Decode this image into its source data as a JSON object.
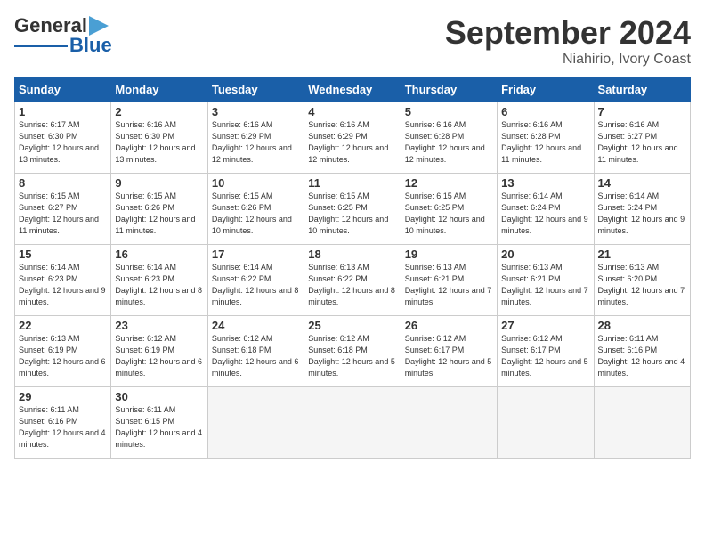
{
  "logo": {
    "line1": "General",
    "line2": "Blue"
  },
  "title": "September 2024",
  "location": "Niahirio, Ivory Coast",
  "days_of_week": [
    "Sunday",
    "Monday",
    "Tuesday",
    "Wednesday",
    "Thursday",
    "Friday",
    "Saturday"
  ],
  "weeks": [
    [
      {
        "day": "1",
        "sunrise": "6:17 AM",
        "sunset": "6:30 PM",
        "daylight": "12 hours and 13 minutes."
      },
      {
        "day": "2",
        "sunrise": "6:16 AM",
        "sunset": "6:30 PM",
        "daylight": "12 hours and 13 minutes."
      },
      {
        "day": "3",
        "sunrise": "6:16 AM",
        "sunset": "6:29 PM",
        "daylight": "12 hours and 12 minutes."
      },
      {
        "day": "4",
        "sunrise": "6:16 AM",
        "sunset": "6:29 PM",
        "daylight": "12 hours and 12 minutes."
      },
      {
        "day": "5",
        "sunrise": "6:16 AM",
        "sunset": "6:28 PM",
        "daylight": "12 hours and 12 minutes."
      },
      {
        "day": "6",
        "sunrise": "6:16 AM",
        "sunset": "6:28 PM",
        "daylight": "12 hours and 11 minutes."
      },
      {
        "day": "7",
        "sunrise": "6:16 AM",
        "sunset": "6:27 PM",
        "daylight": "12 hours and 11 minutes."
      }
    ],
    [
      {
        "day": "8",
        "sunrise": "6:15 AM",
        "sunset": "6:27 PM",
        "daylight": "12 hours and 11 minutes."
      },
      {
        "day": "9",
        "sunrise": "6:15 AM",
        "sunset": "6:26 PM",
        "daylight": "12 hours and 11 minutes."
      },
      {
        "day": "10",
        "sunrise": "6:15 AM",
        "sunset": "6:26 PM",
        "daylight": "12 hours and 10 minutes."
      },
      {
        "day": "11",
        "sunrise": "6:15 AM",
        "sunset": "6:25 PM",
        "daylight": "12 hours and 10 minutes."
      },
      {
        "day": "12",
        "sunrise": "6:15 AM",
        "sunset": "6:25 PM",
        "daylight": "12 hours and 10 minutes."
      },
      {
        "day": "13",
        "sunrise": "6:14 AM",
        "sunset": "6:24 PM",
        "daylight": "12 hours and 9 minutes."
      },
      {
        "day": "14",
        "sunrise": "6:14 AM",
        "sunset": "6:24 PM",
        "daylight": "12 hours and 9 minutes."
      }
    ],
    [
      {
        "day": "15",
        "sunrise": "6:14 AM",
        "sunset": "6:23 PM",
        "daylight": "12 hours and 9 minutes."
      },
      {
        "day": "16",
        "sunrise": "6:14 AM",
        "sunset": "6:23 PM",
        "daylight": "12 hours and 8 minutes."
      },
      {
        "day": "17",
        "sunrise": "6:14 AM",
        "sunset": "6:22 PM",
        "daylight": "12 hours and 8 minutes."
      },
      {
        "day": "18",
        "sunrise": "6:13 AM",
        "sunset": "6:22 PM",
        "daylight": "12 hours and 8 minutes."
      },
      {
        "day": "19",
        "sunrise": "6:13 AM",
        "sunset": "6:21 PM",
        "daylight": "12 hours and 7 minutes."
      },
      {
        "day": "20",
        "sunrise": "6:13 AM",
        "sunset": "6:21 PM",
        "daylight": "12 hours and 7 minutes."
      },
      {
        "day": "21",
        "sunrise": "6:13 AM",
        "sunset": "6:20 PM",
        "daylight": "12 hours and 7 minutes."
      }
    ],
    [
      {
        "day": "22",
        "sunrise": "6:13 AM",
        "sunset": "6:19 PM",
        "daylight": "12 hours and 6 minutes."
      },
      {
        "day": "23",
        "sunrise": "6:12 AM",
        "sunset": "6:19 PM",
        "daylight": "12 hours and 6 minutes."
      },
      {
        "day": "24",
        "sunrise": "6:12 AM",
        "sunset": "6:18 PM",
        "daylight": "12 hours and 6 minutes."
      },
      {
        "day": "25",
        "sunrise": "6:12 AM",
        "sunset": "6:18 PM",
        "daylight": "12 hours and 5 minutes."
      },
      {
        "day": "26",
        "sunrise": "6:12 AM",
        "sunset": "6:17 PM",
        "daylight": "12 hours and 5 minutes."
      },
      {
        "day": "27",
        "sunrise": "6:12 AM",
        "sunset": "6:17 PM",
        "daylight": "12 hours and 5 minutes."
      },
      {
        "day": "28",
        "sunrise": "6:11 AM",
        "sunset": "6:16 PM",
        "daylight": "12 hours and 4 minutes."
      }
    ],
    [
      {
        "day": "29",
        "sunrise": "6:11 AM",
        "sunset": "6:16 PM",
        "daylight": "12 hours and 4 minutes."
      },
      {
        "day": "30",
        "sunrise": "6:11 AM",
        "sunset": "6:15 PM",
        "daylight": "12 hours and 4 minutes."
      },
      null,
      null,
      null,
      null,
      null
    ]
  ]
}
